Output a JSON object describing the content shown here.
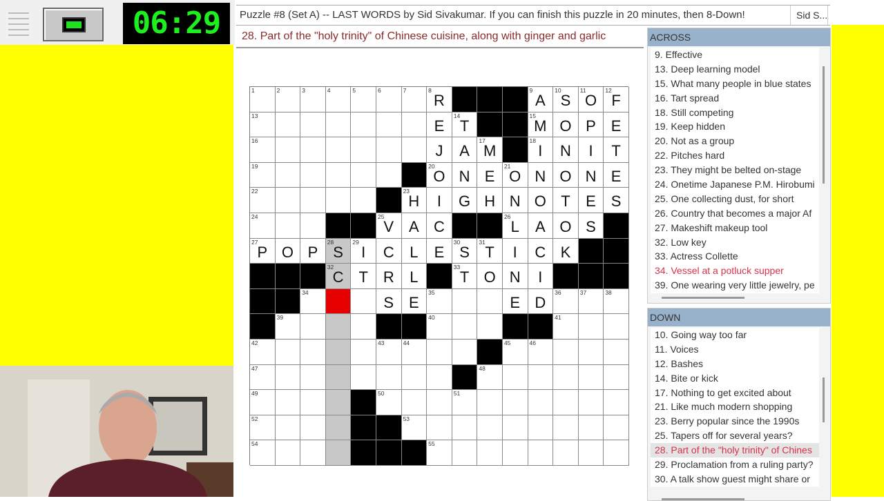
{
  "timer": "06:29",
  "title": "Puzzle #8 (Set A) -- LAST WORDS by Sid Sivakumar. If you can finish this puzzle in 20 minutes, then 8-Down!",
  "author_tab": "Sid S...",
  "current_clue": "28. Part of the \"holy trinity\" of Chinese cuisine, along with ginger and garlic",
  "colors": {
    "background": "#ffff00",
    "timer": "#1ef01e",
    "cursor": "#e60000",
    "highlight": "#c8c8c8",
    "panel_header": "#98b2cc",
    "active_clue": "#d8314a"
  },
  "grid": {
    "rows": [
      ".......R###ASOF",
      ".......ET##MOPE",
      ".......JAM#INIT",
      "......#ONEONONE",
      ".....#HIGHNOTES",
      "...##VAC##LAOS#",
      "POPSICLESTICK##",
      "###CTRL#TONI###",
      "##...SE...ED...",
      "#....##...##...",
      ".........#.....",
      "........#......",
      "....#..........",
      "....##.........",
      "....###........"
    ],
    "cursor": {
      "row": 8,
      "col": 3
    },
    "highlighted_word": "28-Down"
  },
  "across": {
    "header": "ACROSS",
    "clues": [
      "9. Effective",
      "13. Deep learning model",
      "15. What many people in blue states",
      "16. Tart spread",
      "18. Still competing",
      "19. Keep hidden",
      "20. Not as a group",
      "22. Pitches hard",
      "23. They might be belted on-stage",
      "24. Onetime Japanese P.M. Hirobumi",
      "25. One collecting dust, for short",
      "26. Country that becomes a major Af",
      "27. Makeshift makeup tool",
      "32. Low key",
      "33. Actress Collette",
      "34. Vessel at a potluck supper",
      "39. One wearing very little jewelry, pe"
    ],
    "active_index": 15
  },
  "down": {
    "header": "DOWN",
    "clues": [
      "10. Going way too far",
      "11. Voices",
      "12. Bashes",
      "14. Bite or kick",
      "17. Nothing to get excited about",
      "21. Like much modern shopping",
      "23. Berry popular since the 1990s",
      "25. Tapers off for several years?",
      "28. Part of the \"holy trinity\" of Chines",
      "29. Proclamation from a ruling party?",
      "30. A talk show guest might share or"
    ],
    "active_index": 8
  }
}
